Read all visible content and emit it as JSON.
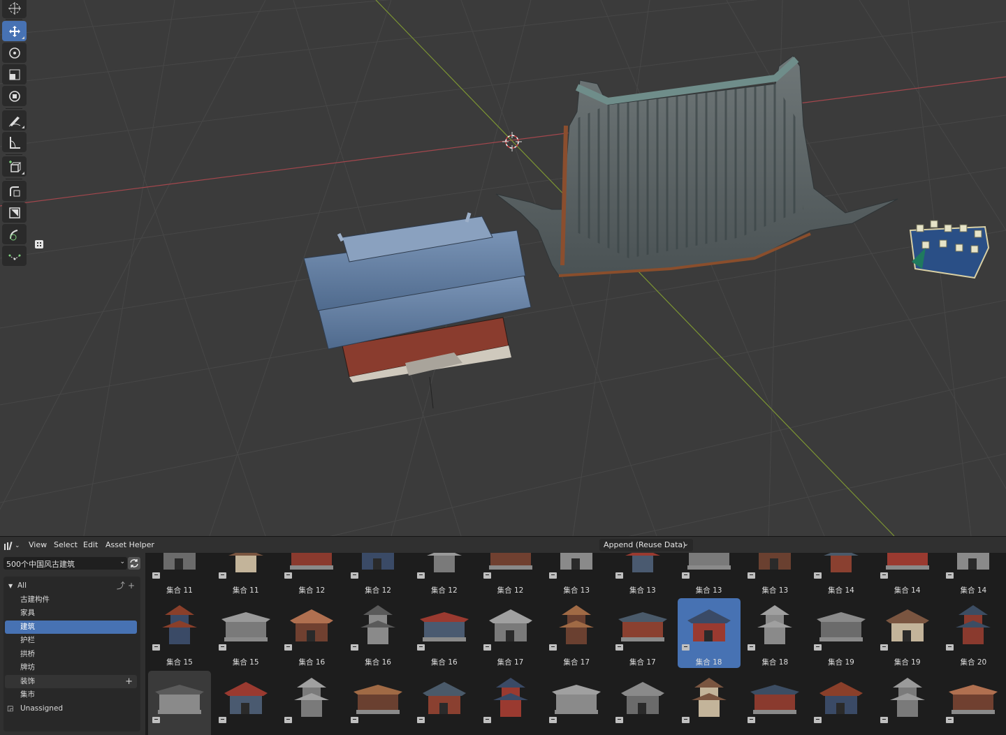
{
  "asset_browser": {
    "header": {
      "view": "View",
      "select": "Select",
      "edit": "Edit",
      "asset_helper": "Asset Helper",
      "import_method": "Append (Reuse Data)"
    },
    "library": "500个中国风古建筑",
    "categories": {
      "all": "All",
      "items": [
        "古建构件",
        "家具",
        "建筑",
        "护栏",
        "拱桥",
        "牌坊",
        "装饰",
        "集市"
      ],
      "selected": "建筑",
      "unassigned": "Unassigned"
    },
    "rows": [
      [
        "集合 11",
        "集合 11",
        "集合 12",
        "集合 12",
        "集合 12",
        "集合 12",
        "集合 13",
        "集合 13",
        "集合 13",
        "集合 13",
        "集合 14",
        "集合 14",
        "集合 14"
      ],
      [
        "集合 15",
        "集合 15",
        "集合 16",
        "集合 16",
        "集合 16",
        "集合 17",
        "集合 17",
        "集合 17",
        "集合 18",
        "集合 18",
        "集合 19",
        "集合 19",
        "集合 20"
      ]
    ],
    "selected_asset": "集合 18"
  },
  "colors": {
    "accent": "#4772b3",
    "x_axis": "#a4474d",
    "y_axis": "#7c9533",
    "grid": "#464646"
  },
  "icons": {
    "toolbar": [
      "cursor-icon",
      "move-icon",
      "rotate-icon",
      "scale-icon",
      "transform-icon",
      "annotate-icon",
      "measure-icon",
      "add-cube-icon",
      "extrude-icon",
      "inset-icon",
      "smooth-icon",
      "shear-icon"
    ]
  }
}
